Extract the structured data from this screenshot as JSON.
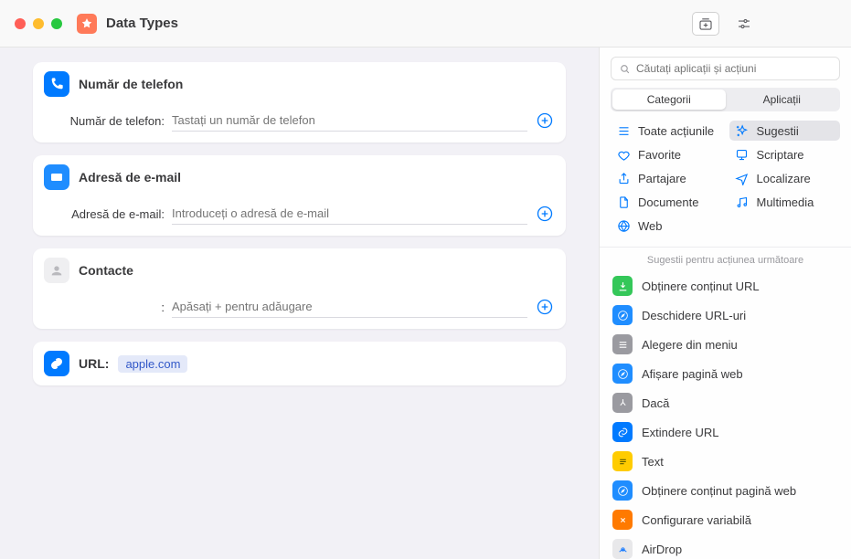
{
  "titlebar": {
    "title": "Data Types"
  },
  "cards": {
    "phone": {
      "title": "Număr de telefon",
      "field_label": "Număr de telefon:",
      "placeholder": "Tastați un număr de telefon"
    },
    "email": {
      "title": "Adresă de e-mail",
      "field_label": "Adresă de e-mail:",
      "placeholder": "Introduceți o adresă de e-mail"
    },
    "contacts": {
      "title": "Contacte",
      "field_label": ":",
      "placeholder": "Apăsați + pentru adăugare"
    },
    "url": {
      "label": "URL:",
      "token": "apple.com"
    }
  },
  "sidebar": {
    "search_placeholder": "Căutați aplicații și acțiuni",
    "segmented": {
      "categories": "Categorii",
      "apps": "Aplicații"
    },
    "categories": [
      {
        "label": "Toate acțiunile"
      },
      {
        "label": "Sugestii"
      },
      {
        "label": "Favorite"
      },
      {
        "label": "Scriptare"
      },
      {
        "label": "Partajare"
      },
      {
        "label": "Localizare"
      },
      {
        "label": "Documente"
      },
      {
        "label": "Multimedia"
      },
      {
        "label": "Web"
      }
    ],
    "suggestions_header": "Sugestii pentru acțiunea următoare",
    "suggestions": [
      {
        "label": "Obținere conținut URL",
        "color": "#34c759",
        "glyph": "download"
      },
      {
        "label": "Deschidere URL-uri",
        "color": "#1f8dff",
        "glyph": "safari"
      },
      {
        "label": "Alegere din meniu",
        "color": "#9a9aa0",
        "glyph": "menu"
      },
      {
        "label": "Afișare pagină web",
        "color": "#1f8dff",
        "glyph": "safari"
      },
      {
        "label": "Dacă",
        "color": "#9a9aa0",
        "glyph": "branch"
      },
      {
        "label": "Extindere URL",
        "color": "#007aff",
        "glyph": "link"
      },
      {
        "label": "Text",
        "color": "#ffcc00",
        "glyph": "text"
      },
      {
        "label": "Obținere conținut pagină web",
        "color": "#1f8dff",
        "glyph": "safari"
      },
      {
        "label": "Configurare variabilă",
        "color": "#ff7a00",
        "glyph": "var"
      },
      {
        "label": "AirDrop",
        "color": "#e8e8ea",
        "glyph": "airdrop"
      }
    ]
  }
}
